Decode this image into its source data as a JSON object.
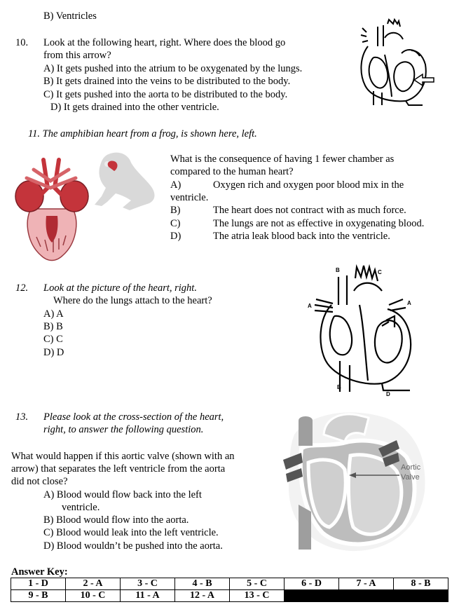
{
  "q9": {
    "option_b": "B)  Ventricles"
  },
  "q10": {
    "number": "10.",
    "stem_line1": "Look at the following heart, right.  Where does the blood go",
    "stem_line2": "from this arrow?",
    "options": [
      "A)  It gets pushed into the atrium to be oxygenated by the lungs.",
      "B)  It gets drained into the veins to be distributed to the body.",
      "C)  It gets pushed into the aorta to be distributed to the body.",
      "D)  It gets drained into the other ventricle."
    ]
  },
  "q11": {
    "number_and_intro": "11. The amphibian heart from a frog, is shown here, left.",
    "stem_line1": "What is the consequence of having 1 fewer chamber as",
    "stem_line2": "compared to the human heart?",
    "optA_letter": "A)",
    "optA_text": "Oxygen rich and oxygen poor blood mix in the",
    "optA_cont": "ventricle.",
    "optB_letter": "B)",
    "optB_text": "The heart does not contract with as much force.",
    "optC_letter": "C)",
    "optC_text": "The lungs are not as effective in oxygenating blood.",
    "optD_letter": "D)",
    "optD_text": "The atria leak blood back into the ventricle."
  },
  "q12": {
    "number": "12.",
    "stem_line1": "Look at the picture of the heart, right.",
    "stem_line2": "Where do the lungs attach to the heart?",
    "options": [
      "A) A",
      "B) B",
      "C) C",
      "D) D"
    ],
    "diagram_labels": {
      "a_left": "A",
      "a_right": "A",
      "b_top": "B",
      "b_bottom": "B",
      "c": "C",
      "d": "D"
    }
  },
  "q13": {
    "number": "13.",
    "intro_line1": "Please look at the cross-section of the heart,",
    "intro_line2": "right, to answer the following question.",
    "stem_line1": "What would happen if this aortic valve (shown with an",
    "stem_line2": "arrow) that separates the left ventricle from the aorta",
    "stem_line3": "did not close?",
    "optA_line1": "A)  Blood would flow back into the left",
    "optA_line2": "ventricle.",
    "optB": "B)  Blood would flow into the aorta.",
    "optC": "C)  Blood would leak into the left ventricle.",
    "optD": "D)  Blood wouldn’t be pushed into the aorta.",
    "diagram_label_line1": "Aortic",
    "diagram_label_line2": "Valve"
  },
  "answer_key": {
    "title": "Answer Key:",
    "row1": [
      "1 - D",
      "2 - A",
      "3 - C",
      "4 - B",
      "5 - C",
      "6 - D",
      "7 - A",
      "8 - B"
    ],
    "row2": [
      "9 - B",
      "10 - C",
      "11 - A",
      "12 - A",
      "13 - C"
    ]
  },
  "colors": {
    "heart_red": "#c4343b",
    "heart_pink": "#e9a6aa",
    "frog_gray": "#d9d9d9",
    "section_gray": "#bdbdbd",
    "dark_gray": "#555555"
  }
}
